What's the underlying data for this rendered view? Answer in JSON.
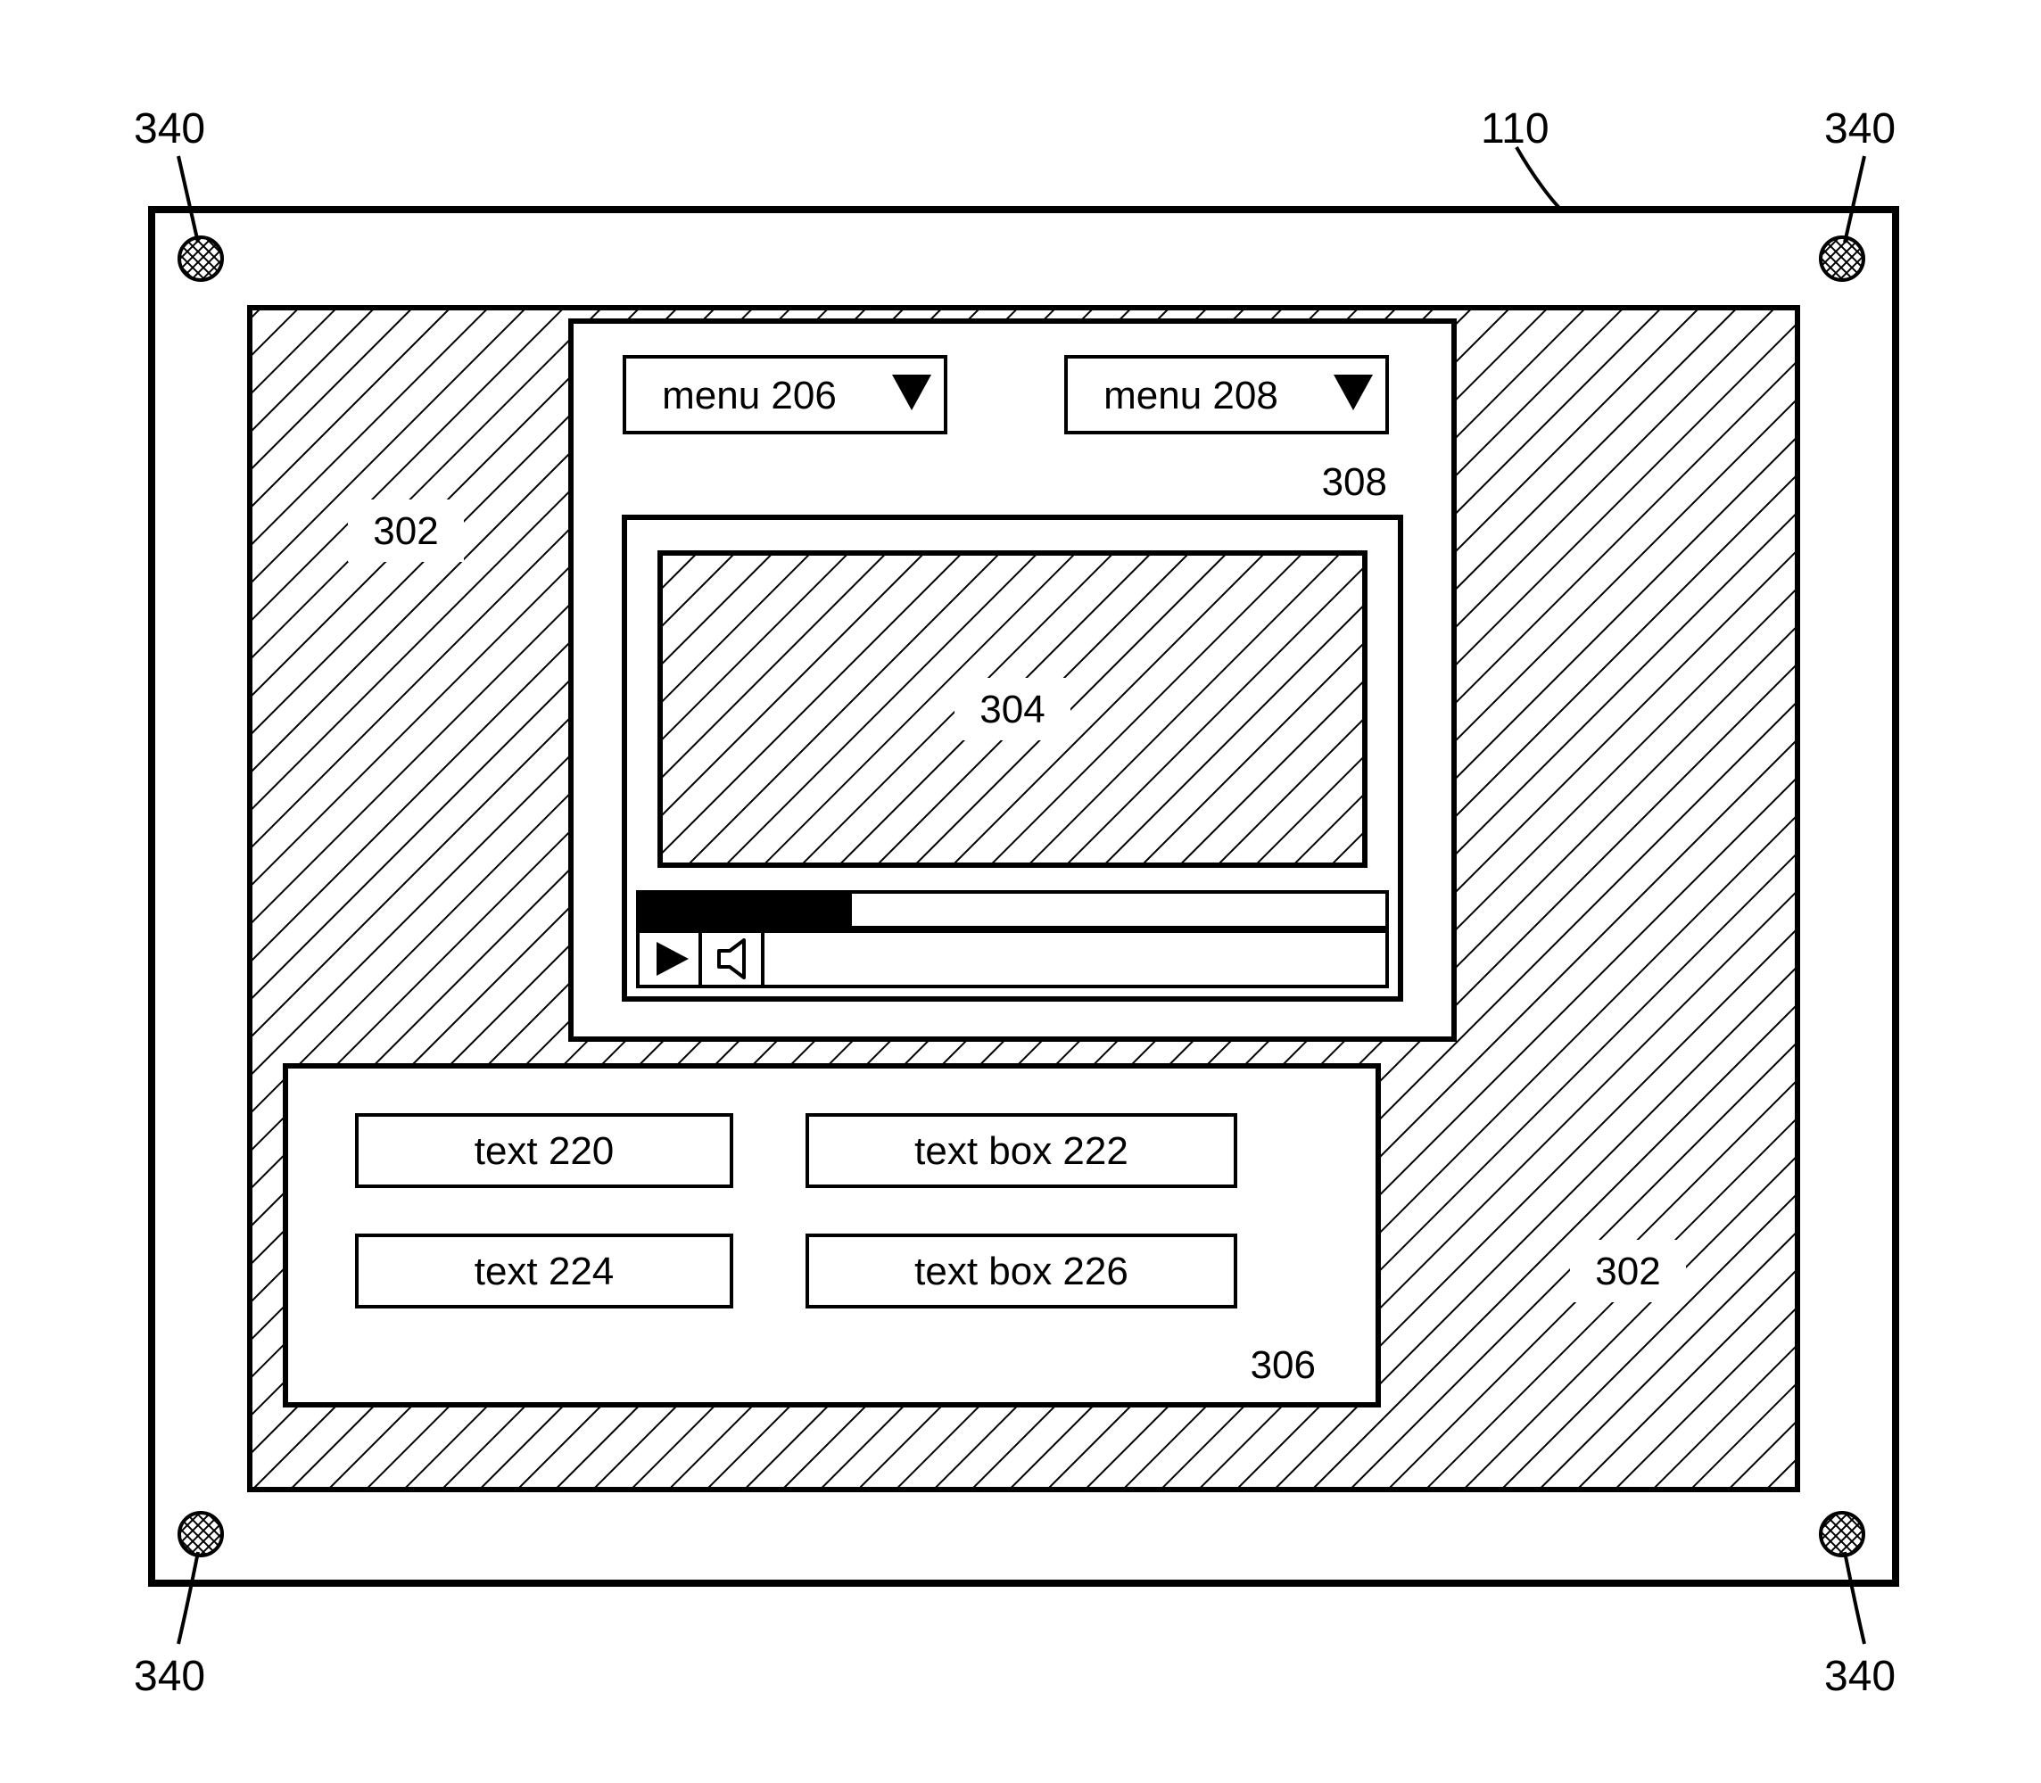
{
  "callouts": {
    "screw_tl": "340",
    "screw_tr": "340",
    "screw_bl": "340",
    "screw_br": "340",
    "device": "110",
    "bg_left": "302",
    "bg_right": "302",
    "video": "304",
    "form": "306",
    "menus": "308"
  },
  "menus": {
    "menu_a": "menu 206",
    "menu_b": "menu 208"
  },
  "form": {
    "label_a": "text 220",
    "box_a": "text box 222",
    "label_b": "text 224",
    "box_b": "text box 226"
  }
}
